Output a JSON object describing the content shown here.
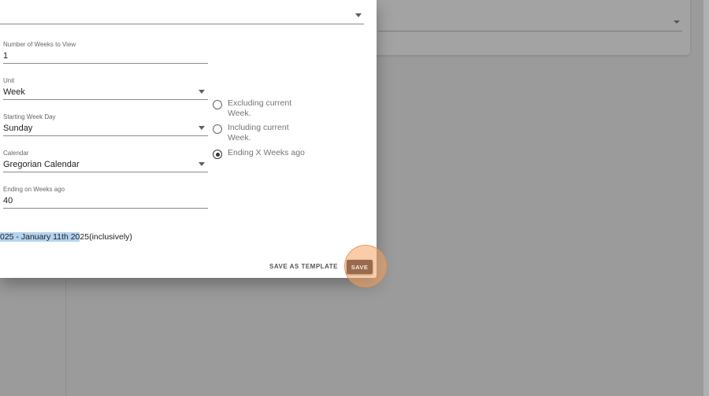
{
  "form": {
    "weeks_to_view": {
      "label": "Number of Weeks to View",
      "value": "1"
    },
    "unit": {
      "label": "Unit",
      "value": "Week"
    },
    "starting_week_day": {
      "label": "Starting Week Day",
      "value": "Sunday"
    },
    "calendar": {
      "label": "Calendar",
      "value": "Gregorian Calendar"
    },
    "ending_weeks_ago": {
      "label": "Ending on Weeks ago",
      "value": "40"
    }
  },
  "range_options": [
    {
      "label": "Excluding current Week.",
      "checked": false
    },
    {
      "label": "Including current Week.",
      "checked": false
    },
    {
      "label": "Ending X Weeks ago",
      "checked": true
    }
  ],
  "date_range": {
    "highlighted": "025 - January 11th 20",
    "rest": "25(inclusively)"
  },
  "actions": {
    "save_as_template": "SAVE AS TEMPLATE",
    "save": "SAVE"
  },
  "colors": {
    "overlay": "#9b9b9b",
    "selection_highlight": "#b3d3f0",
    "save_button": "#9a6a4e",
    "focus_ring": "#f4a462"
  }
}
